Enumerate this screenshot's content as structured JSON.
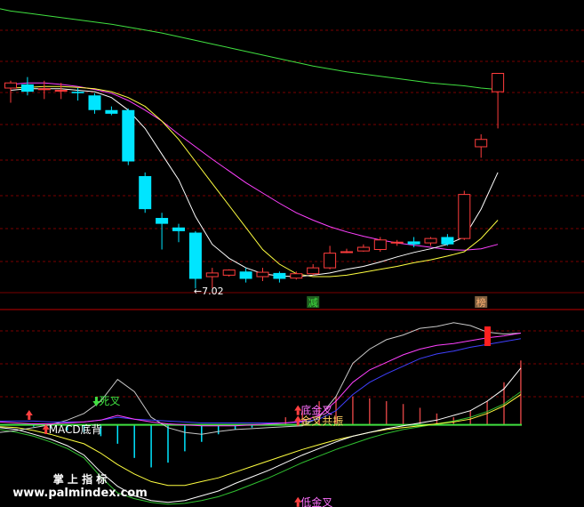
{
  "colors": {
    "up": "#ff3c3c",
    "down": "#00e5ff",
    "ma_white": "#ffffff",
    "ma_yellow": "#ffff40",
    "ma_magenta": "#ff40ff",
    "ma_green": "#40e040",
    "grid": "#7a0000",
    "divider": "#c00000"
  },
  "chart_data": [
    {
      "type": "candlestick",
      "title": "",
      "candles": [
        {
          "o": 9.75,
          "h": 9.85,
          "l": 9.55,
          "c": 9.82
        },
        {
          "o": 9.8,
          "h": 9.9,
          "l": 9.65,
          "c": 9.7
        },
        {
          "o": 9.74,
          "h": 9.85,
          "l": 9.6,
          "c": 9.74
        },
        {
          "o": 9.72,
          "h": 9.82,
          "l": 9.6,
          "c": 9.72
        },
        {
          "o": 9.7,
          "h": 9.75,
          "l": 9.58,
          "c": 9.68
        },
        {
          "o": 9.65,
          "h": 9.68,
          "l": 9.4,
          "c": 9.45
        },
        {
          "o": 9.45,
          "h": 9.5,
          "l": 9.38,
          "c": 9.4
        },
        {
          "o": 9.45,
          "h": 9.47,
          "l": 8.7,
          "c": 8.75
        },
        {
          "o": 8.55,
          "h": 8.6,
          "l": 8.05,
          "c": 8.1
        },
        {
          "o": 7.98,
          "h": 8.05,
          "l": 7.55,
          "c": 7.9
        },
        {
          "o": 7.85,
          "h": 7.9,
          "l": 7.65,
          "c": 7.8
        },
        {
          "o": 7.78,
          "h": 7.8,
          "l": 7.02,
          "c": 7.15
        },
        {
          "o": 7.18,
          "h": 7.3,
          "l": 7.02,
          "c": 7.23
        },
        {
          "o": 7.2,
          "h": 7.28,
          "l": 7.18,
          "c": 7.27
        },
        {
          "o": 7.25,
          "h": 7.3,
          "l": 7.1,
          "c": 7.15
        },
        {
          "o": 7.18,
          "h": 7.3,
          "l": 7.12,
          "c": 7.24
        },
        {
          "o": 7.23,
          "h": 7.25,
          "l": 7.1,
          "c": 7.15
        },
        {
          "o": 7.16,
          "h": 7.25,
          "l": 7.14,
          "c": 7.22
        },
        {
          "o": 7.22,
          "h": 7.35,
          "l": 7.2,
          "c": 7.3
        },
        {
          "o": 7.3,
          "h": 7.6,
          "l": 7.28,
          "c": 7.5
        },
        {
          "o": 7.52,
          "h": 7.56,
          "l": 7.5,
          "c": 7.52
        },
        {
          "o": 7.53,
          "h": 7.62,
          "l": 7.52,
          "c": 7.58
        },
        {
          "o": 7.55,
          "h": 7.72,
          "l": 7.52,
          "c": 7.68
        },
        {
          "o": 7.65,
          "h": 7.68,
          "l": 7.6,
          "c": 7.65
        },
        {
          "o": 7.66,
          "h": 7.72,
          "l": 7.58,
          "c": 7.62
        },
        {
          "o": 7.64,
          "h": 7.72,
          "l": 7.6,
          "c": 7.7
        },
        {
          "o": 7.72,
          "h": 7.76,
          "l": 7.6,
          "c": 7.62
        },
        {
          "o": 7.7,
          "h": 8.35,
          "l": 7.68,
          "c": 8.3
        },
        {
          "o": 8.95,
          "h": 9.12,
          "l": 8.8,
          "c": 9.05
        },
        {
          "o": 9.7,
          "h": 9.95,
          "l": 9.2,
          "c": 9.95
        }
      ],
      "ma_white": [
        9.72,
        9.74,
        9.74,
        9.74,
        9.72,
        9.7,
        9.62,
        9.45,
        9.2,
        8.85,
        8.5,
        8.0,
        7.62,
        7.43,
        7.3,
        7.22,
        7.19,
        7.18,
        7.2,
        7.23,
        7.28,
        7.32,
        7.38,
        7.45,
        7.51,
        7.56,
        7.62,
        7.72,
        8.1,
        8.6
      ],
      "ma_yellow": [
        9.75,
        9.76,
        9.77,
        9.77,
        9.76,
        9.74,
        9.7,
        9.62,
        9.5,
        9.3,
        9.05,
        8.75,
        8.45,
        8.15,
        7.85,
        7.55,
        7.35,
        7.22,
        7.18,
        7.18,
        7.2,
        7.24,
        7.28,
        7.32,
        7.37,
        7.41,
        7.46,
        7.52,
        7.7,
        7.95
      ],
      "ma_magenta": [
        9.8,
        9.82,
        9.82,
        9.8,
        9.77,
        9.73,
        9.68,
        9.58,
        9.45,
        9.3,
        9.12,
        8.95,
        8.78,
        8.62,
        8.46,
        8.32,
        8.18,
        8.05,
        7.95,
        7.86,
        7.79,
        7.73,
        7.68,
        7.64,
        7.61,
        7.58,
        7.55,
        7.54,
        7.56,
        7.62
      ],
      "ma_green": [
        10.8,
        10.77,
        10.74,
        10.71,
        10.68,
        10.65,
        10.62,
        10.58,
        10.54,
        10.5,
        10.45,
        10.4,
        10.35,
        10.3,
        10.25,
        10.2,
        10.15,
        10.1,
        10.05,
        10.01,
        9.97,
        9.94,
        9.91,
        9.88,
        9.85,
        9.82,
        9.8,
        9.78,
        9.75,
        9.73
      ],
      "ylim": [
        6.95,
        10.95
      ],
      "annotations": [
        {
          "text": "←7.02",
          "i": 11,
          "price": 7.02
        },
        {
          "text": "减",
          "i": 18,
          "color": "#40e040",
          "bg": "#206020"
        },
        {
          "text": "榜",
          "i": 28,
          "color": "#ffb070",
          "bg": "#806040"
        }
      ]
    },
    {
      "type": "indicator",
      "ylim": [
        -85,
        120
      ],
      "white": [
        -8,
        -6,
        -3,
        0,
        5,
        12,
        25,
        48,
        35,
        8,
        -3,
        -8,
        -10,
        -7,
        -5,
        -4,
        -3,
        -2,
        -1,
        8,
        30,
        65,
        80,
        90,
        95,
        102,
        104,
        108,
        105,
        98,
        96,
        97
      ],
      "magenta": [
        3,
        2,
        1,
        1,
        2,
        3,
        5,
        10,
        6,
        3,
        1,
        0,
        -1,
        -1,
        -1,
        0,
        1,
        2,
        4,
        10,
        25,
        45,
        58,
        66,
        74,
        80,
        84,
        86,
        89,
        92,
        94,
        97
      ],
      "blue": [
        4,
        4,
        4,
        3,
        3,
        3,
        5,
        8,
        6,
        5,
        4,
        3,
        2,
        2,
        2,
        2,
        2,
        2,
        3,
        6,
        15,
        32,
        45,
        54,
        62,
        70,
        75,
        78,
        82,
        85,
        88,
        91
      ],
      "lower_white": [
        -3,
        -5,
        -10,
        -15,
        -22,
        -32,
        -50,
        -65,
        -75,
        -80,
        -82,
        -80,
        -75,
        -70,
        -62,
        -55,
        -48,
        -40,
        -32,
        -25,
        -18,
        -12,
        -8,
        -4,
        -1,
        2,
        5,
        10,
        15,
        25,
        38,
        60
      ],
      "lower_yellow": [
        -2,
        -3,
        -6,
        -10,
        -15,
        -20,
        -30,
        -42,
        -52,
        -60,
        -64,
        -64,
        -60,
        -56,
        -50,
        -44,
        -38,
        -32,
        -26,
        -21,
        -16,
        -12,
        -8,
        -5,
        -3,
        -1,
        1,
        3,
        6,
        12,
        20,
        32
      ],
      "lower_green": [
        -5,
        -8,
        -12,
        -18,
        -25,
        -35,
        -55,
        -72,
        -78,
        -82,
        -84,
        -83,
        -80,
        -76,
        -70,
        -63,
        -56,
        -48,
        -40,
        -33,
        -26,
        -20,
        -14,
        -9,
        -5,
        -2,
        1,
        4,
        8,
        14,
        22,
        35
      ],
      "histogram": [
        0,
        0,
        -2,
        -4,
        -6,
        -8,
        -12,
        -20,
        -35,
        -45,
        -40,
        -28,
        -18,
        -10,
        -5,
        -3,
        2,
        8,
        15,
        25,
        30,
        30,
        28,
        25,
        22,
        18,
        12,
        8,
        15,
        25,
        45,
        68
      ],
      "signals": [
        {
          "text": "死叉",
          "color": "#40e040",
          "i": 6,
          "v": 25,
          "dir": "down"
        },
        {
          "text": "",
          "color": "#ff4040",
          "i": 2,
          "v": 10,
          "dir": "up"
        },
        {
          "text": "底金叉",
          "color": "#ff70ff",
          "i": 18,
          "v": 15,
          "dir": "up"
        },
        {
          "text": "金叉共振",
          "color": "#ffd060",
          "i": 18,
          "v": 4,
          "dir": "up"
        },
        {
          "text": "MACD底背",
          "color": "#ffffff",
          "i": 3,
          "v": -5,
          "dir": "up"
        },
        {
          "text": "低金叉",
          "color": "#ff70ff",
          "i": 18,
          "v": -82,
          "dir": "up"
        }
      ]
    }
  ],
  "watermark": {
    "line1": "掌 上 指 标",
    "line2": "www.palmindex.com"
  }
}
